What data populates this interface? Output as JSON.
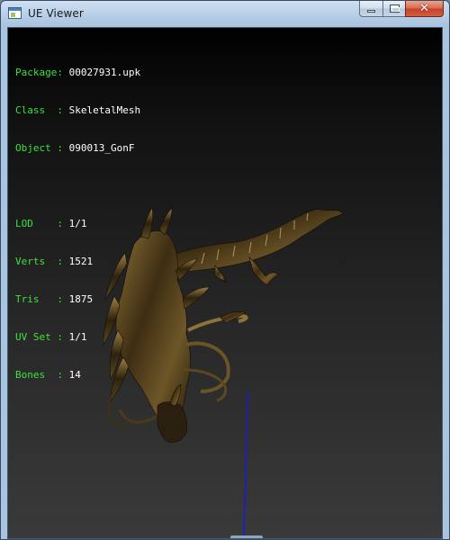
{
  "window": {
    "title": "UE Viewer",
    "icon": "app-window-icon",
    "buttons": {
      "minimize": "minimize-icon",
      "maximize": "maximize-icon",
      "close": "close-icon"
    },
    "close_glyph": "✕"
  },
  "info": {
    "package_label": "Package: ",
    "package_value": "00027931.upk",
    "class_label": "Class  : ",
    "class_value": "SkeletalMesh",
    "object_label": "Object : ",
    "object_value": "090013_GonF",
    "lod_label": "LOD    : ",
    "lod_value": "1/1",
    "verts_label": "Verts  : ",
    "verts_value": "1521",
    "tris_label": "Tris   : ",
    "tris_value": "1875",
    "uvset_label": "UV Set : ",
    "uvset_value": "1/1",
    "bones_label": "Bones  : ",
    "bones_value": "14"
  },
  "colors": {
    "label_text": "#3ce23c",
    "value_text": "#ffffff",
    "mesh_dark": "#2a1f0d",
    "mesh_highlight": "#a88a48",
    "axis_line": "#1b1bd6"
  }
}
